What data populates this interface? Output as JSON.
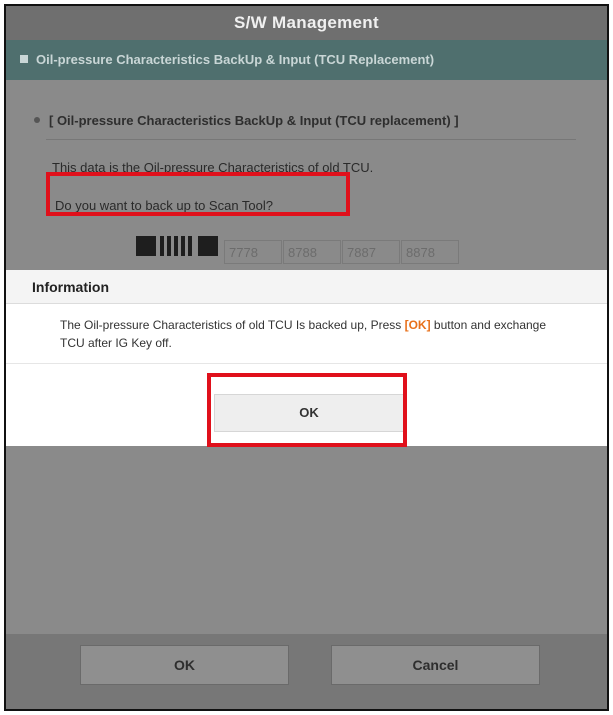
{
  "window": {
    "title": "S/W Management"
  },
  "section": {
    "title": "Oil-pressure Characteristics BackUp & Input (TCU Replacement)"
  },
  "content": {
    "bullet_title": "[ Oil-pressure Characteristics BackUp & Input (TCU replacement) ]",
    "line1": "This data is the Oil-pressure Characteristics of old TCU.",
    "line2": "Do you want to back up to Scan Tool?",
    "codes": [
      "7778",
      "8788",
      "7887",
      "8878"
    ]
  },
  "dialog": {
    "title": "Information",
    "message_before": "The Oil-pressure Characteristics of old TCU Is backed up, Press ",
    "message_ok": "[OK]",
    "message_after": " button and exchange TCU after IG Key off.",
    "ok_label": "OK"
  },
  "footer": {
    "ok_label": "OK",
    "cancel_label": "Cancel"
  },
  "colors": {
    "highlight_red": "#e0101b",
    "ok_orange": "#e8701a",
    "section_teal": "#4f6f6e"
  }
}
